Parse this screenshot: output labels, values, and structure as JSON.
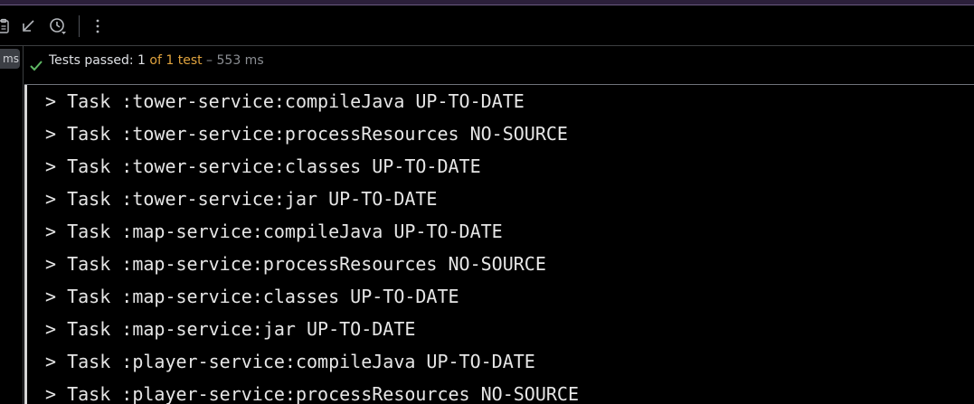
{
  "toolbar": {
    "icons": [
      {
        "name": "clipboard-icon"
      },
      {
        "name": "collapse-arrow-icon"
      },
      {
        "name": "history-icon"
      },
      {
        "name": "more-options-icon"
      }
    ]
  },
  "left_strip": {
    "duration_label": "ms"
  },
  "status": {
    "prefix": "Tests passed: ",
    "passed_count": "1",
    "of_total": " of 1 test",
    "duration": " – 553 ms",
    "accent_color": "#e0a33e",
    "check_color": "#5fb865"
  },
  "console": {
    "lines": [
      "> Task :tower-service:compileJava UP-TO-DATE",
      "> Task :tower-service:processResources NO-SOURCE",
      "> Task :tower-service:classes UP-TO-DATE",
      "> Task :tower-service:jar UP-TO-DATE",
      "> Task :map-service:compileJava UP-TO-DATE",
      "> Task :map-service:processResources NO-SOURCE",
      "> Task :map-service:classes UP-TO-DATE",
      "> Task :map-service:jar UP-TO-DATE",
      "> Task :player-service:compileJava UP-TO-DATE",
      "> Task :player-service:processResources NO-SOURCE"
    ]
  }
}
